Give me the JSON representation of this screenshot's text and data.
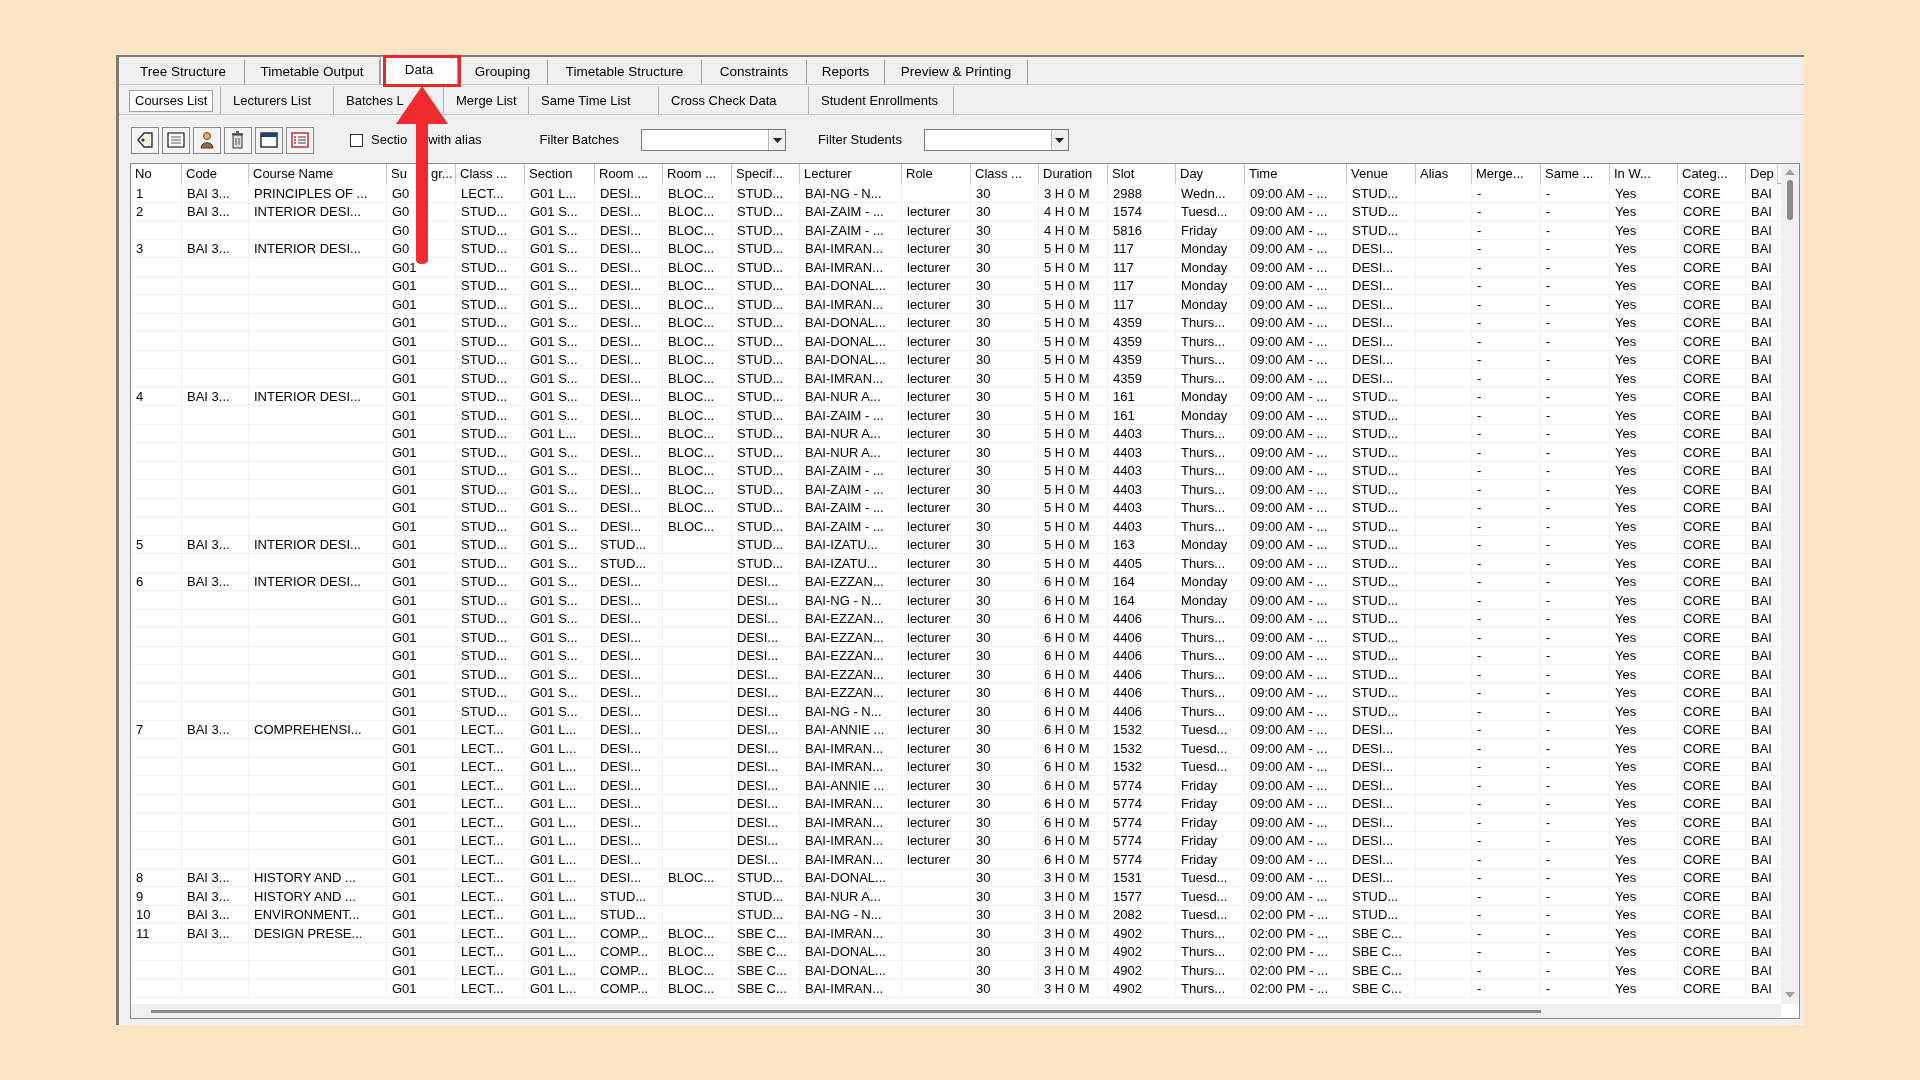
{
  "tabs": [
    {
      "label": "Tree Structure",
      "selected": false
    },
    {
      "label": "Timetable Output",
      "selected": false
    },
    {
      "label": "Data",
      "selected": true
    },
    {
      "label": "Grouping",
      "selected": false
    },
    {
      "label": "Timetable Structure",
      "selected": false
    },
    {
      "label": "Constraints",
      "selected": false
    },
    {
      "label": "Reports",
      "selected": false
    },
    {
      "label": "Preview & Printing",
      "selected": false
    }
  ],
  "sub_tabs": [
    {
      "label": "Courses List",
      "selected": true
    },
    {
      "label": "Lecturers List",
      "selected": false
    },
    {
      "label": "Batches L",
      "selected": false
    },
    {
      "label": "Merge List",
      "selected": false
    },
    {
      "label": "Same Time List",
      "selected": false
    },
    {
      "label": "Cross Check Data",
      "selected": false
    },
    {
      "label": "Student Enrollments",
      "selected": false
    }
  ],
  "toolbar": {
    "sections_checkbox": {
      "label_parts": [
        "Sectio",
        "with alias"
      ],
      "checked": false
    },
    "filter_batches": {
      "label": "Filter Batches"
    },
    "filter_students": {
      "label": "Filter Students"
    }
  },
  "table": {
    "columns": [
      {
        "label_parts": [
          "No"
        ]
      },
      {
        "label_parts": [
          "Code"
        ]
      },
      {
        "label_parts": [
          "Course Name"
        ]
      },
      {
        "label_parts": [
          "Su",
          "gr..."
        ]
      },
      {
        "label_parts": [
          "Class ..."
        ]
      },
      {
        "label_parts": [
          "Section"
        ]
      },
      {
        "label_parts": [
          "Room ..."
        ]
      },
      {
        "label_parts": [
          "Room ..."
        ]
      },
      {
        "label_parts": [
          "Specif..."
        ]
      },
      {
        "label_parts": [
          "Lecturer"
        ]
      },
      {
        "label_parts": [
          "Role"
        ]
      },
      {
        "label_parts": [
          "Class ..."
        ]
      },
      {
        "label_parts": [
          "Duration"
        ]
      },
      {
        "label_parts": [
          "Slot"
        ]
      },
      {
        "label_parts": [
          "Day"
        ]
      },
      {
        "label_parts": [
          "Time"
        ]
      },
      {
        "label_parts": [
          "Venue"
        ]
      },
      {
        "label_parts": [
          "Alias"
        ]
      },
      {
        "label_parts": [
          "Merge..."
        ]
      },
      {
        "label_parts": [
          "Same ..."
        ]
      },
      {
        "label_parts": [
          "In W..."
        ]
      },
      {
        "label_parts": [
          "Categ..."
        ]
      },
      {
        "label_parts": [
          "Dep"
        ]
      }
    ],
    "rows": [
      [
        "1",
        "BAI 3...",
        "PRINCIPLES OF ...",
        "G0",
        "LECT...",
        "G01 L...",
        "DESI...",
        "BLOC...",
        "STUD...",
        "BAI-NG - N...",
        null,
        "30",
        "3 H 0 M",
        "2988",
        "Wedn...",
        "09:00 AM - ...",
        "STUD...",
        null,
        "-",
        "-",
        "Yes",
        "CORE",
        "BAI"
      ],
      [
        "2",
        "BAI 3...",
        "INTERIOR DESI...",
        "G0",
        "STUD...",
        "G01 S...",
        "DESI...",
        "BLOC...",
        "STUD...",
        "BAI-ZAIM - ...",
        "lecturer",
        "30",
        "4 H 0 M",
        "1574",
        "Tuesd...",
        "09:00 AM - ...",
        "STUD...",
        null,
        "-",
        "-",
        "Yes",
        "CORE",
        "BAI"
      ],
      [
        null,
        null,
        null,
        "G0",
        "STUD...",
        "G01 S...",
        "DESI...",
        "BLOC...",
        "STUD...",
        "BAI-ZAIM - ...",
        "lecturer",
        "30",
        "4 H 0 M",
        "5816",
        "Friday",
        "09:00 AM - ...",
        "STUD...",
        null,
        "-",
        "-",
        "Yes",
        "CORE",
        "BAI"
      ],
      [
        "3",
        "BAI 3...",
        "INTERIOR DESI...",
        "G0",
        "STUD...",
        "G01 S...",
        "DESI...",
        "BLOC...",
        "STUD...",
        "BAI-IMRAN...",
        "lecturer",
        "30",
        "5 H 0 M",
        "117",
        "Monday",
        "09:00 AM - ...",
        "DESI...",
        null,
        "-",
        "-",
        "Yes",
        "CORE",
        "BAI"
      ],
      [
        null,
        null,
        null,
        "G01",
        "STUD...",
        "G01 S...",
        "DESI...",
        "BLOC...",
        "STUD...",
        "BAI-IMRAN...",
        "lecturer",
        "30",
        "5 H 0 M",
        "117",
        "Monday",
        "09:00 AM - ...",
        "DESI...",
        null,
        "-",
        "-",
        "Yes",
        "CORE",
        "BAI"
      ],
      [
        null,
        null,
        null,
        "G01",
        "STUD...",
        "G01 S...",
        "DESI...",
        "BLOC...",
        "STUD...",
        "BAI-DONAL...",
        "lecturer",
        "30",
        "5 H 0 M",
        "117",
        "Monday",
        "09:00 AM - ...",
        "DESI...",
        null,
        "-",
        "-",
        "Yes",
        "CORE",
        "BAI"
      ],
      [
        null,
        null,
        null,
        "G01",
        "STUD...",
        "G01 S...",
        "DESI...",
        "BLOC...",
        "STUD...",
        "BAI-IMRAN...",
        "lecturer",
        "30",
        "5 H 0 M",
        "117",
        "Monday",
        "09:00 AM - ...",
        "DESI...",
        null,
        "-",
        "-",
        "Yes",
        "CORE",
        "BAI"
      ],
      [
        null,
        null,
        null,
        "G01",
        "STUD...",
        "G01 S...",
        "DESI...",
        "BLOC...",
        "STUD...",
        "BAI-DONAL...",
        "lecturer",
        "30",
        "5 H 0 M",
        "4359",
        "Thurs...",
        "09:00 AM - ...",
        "DESI...",
        null,
        "-",
        "-",
        "Yes",
        "CORE",
        "BAI"
      ],
      [
        null,
        null,
        null,
        "G01",
        "STUD...",
        "G01 S...",
        "DESI...",
        "BLOC...",
        "STUD...",
        "BAI-DONAL...",
        "lecturer",
        "30",
        "5 H 0 M",
        "4359",
        "Thurs...",
        "09:00 AM - ...",
        "DESI...",
        null,
        "-",
        "-",
        "Yes",
        "CORE",
        "BAI"
      ],
      [
        null,
        null,
        null,
        "G01",
        "STUD...",
        "G01 S...",
        "DESI...",
        "BLOC...",
        "STUD...",
        "BAI-DONAL...",
        "lecturer",
        "30",
        "5 H 0 M",
        "4359",
        "Thurs...",
        "09:00 AM - ...",
        "DESI...",
        null,
        "-",
        "-",
        "Yes",
        "CORE",
        "BAI"
      ],
      [
        null,
        null,
        null,
        "G01",
        "STUD...",
        "G01 S...",
        "DESI...",
        "BLOC...",
        "STUD...",
        "BAI-IMRAN...",
        "lecturer",
        "30",
        "5 H 0 M",
        "4359",
        "Thurs...",
        "09:00 AM - ...",
        "DESI...",
        null,
        "-",
        "-",
        "Yes",
        "CORE",
        "BAI"
      ],
      [
        "4",
        "BAI 3...",
        "INTERIOR DESI...",
        "G01",
        "STUD...",
        "G01 S...",
        "DESI...",
        "BLOC...",
        "STUD...",
        "BAI-NUR A...",
        "lecturer",
        "30",
        "5 H 0 M",
        "161",
        "Monday",
        "09:00 AM - ...",
        "STUD...",
        null,
        "-",
        "-",
        "Yes",
        "CORE",
        "BAI"
      ],
      [
        null,
        null,
        null,
        "G01",
        "STUD...",
        "G01 S...",
        "DESI...",
        "BLOC...",
        "STUD...",
        "BAI-ZAIM - ...",
        "lecturer",
        "30",
        "5 H 0 M",
        "161",
        "Monday",
        "09:00 AM - ...",
        "STUD...",
        null,
        "-",
        "-",
        "Yes",
        "CORE",
        "BAI"
      ],
      [
        null,
        null,
        null,
        "G01",
        "STUD...",
        "G01 L...",
        "DESI...",
        "BLOC...",
        "STUD...",
        "BAI-NUR A...",
        "lecturer",
        "30",
        "5 H 0 M",
        "4403",
        "Thurs...",
        "09:00 AM - ...",
        "STUD...",
        null,
        "-",
        "-",
        "Yes",
        "CORE",
        "BAI"
      ],
      [
        null,
        null,
        null,
        "G01",
        "STUD...",
        "G01 S...",
        "DESI...",
        "BLOC...",
        "STUD...",
        "BAI-NUR A...",
        "lecturer",
        "30",
        "5 H 0 M",
        "4403",
        "Thurs...",
        "09:00 AM - ...",
        "STUD...",
        null,
        "-",
        "-",
        "Yes",
        "CORE",
        "BAI"
      ],
      [
        null,
        null,
        null,
        "G01",
        "STUD...",
        "G01 S...",
        "DESI...",
        "BLOC...",
        "STUD...",
        "BAI-ZAIM - ...",
        "lecturer",
        "30",
        "5 H 0 M",
        "4403",
        "Thurs...",
        "09:00 AM - ...",
        "STUD...",
        null,
        "-",
        "-",
        "Yes",
        "CORE",
        "BAI"
      ],
      [
        null,
        null,
        null,
        "G01",
        "STUD...",
        "G01 S...",
        "DESI...",
        "BLOC...",
        "STUD...",
        "BAI-ZAIM - ...",
        "lecturer",
        "30",
        "5 H 0 M",
        "4403",
        "Thurs...",
        "09:00 AM - ...",
        "STUD...",
        null,
        "-",
        "-",
        "Yes",
        "CORE",
        "BAI"
      ],
      [
        null,
        null,
        null,
        "G01",
        "STUD...",
        "G01 S...",
        "DESI...",
        "BLOC...",
        "STUD...",
        "BAI-ZAIM - ...",
        "lecturer",
        "30",
        "5 H 0 M",
        "4403",
        "Thurs...",
        "09:00 AM - ...",
        "STUD...",
        null,
        "-",
        "-",
        "Yes",
        "CORE",
        "BAI"
      ],
      [
        null,
        null,
        null,
        "G01",
        "STUD...",
        "G01 S...",
        "DESI...",
        "BLOC...",
        "STUD...",
        "BAI-ZAIM - ...",
        "lecturer",
        "30",
        "5 H 0 M",
        "4403",
        "Thurs...",
        "09:00 AM - ...",
        "STUD...",
        null,
        "-",
        "-",
        "Yes",
        "CORE",
        "BAI"
      ],
      [
        "5",
        "BAI 3...",
        "INTERIOR DESI...",
        "G01",
        "STUD...",
        "G01 S...",
        "STUD...",
        null,
        "STUD...",
        "BAI-IZATU...",
        "lecturer",
        "30",
        "5 H 0 M",
        "163",
        "Monday",
        "09:00 AM - ...",
        "STUD...",
        null,
        "-",
        "-",
        "Yes",
        "CORE",
        "BAI"
      ],
      [
        null,
        null,
        null,
        "G01",
        "STUD...",
        "G01 S...",
        "STUD...",
        null,
        "STUD...",
        "BAI-IZATU...",
        "lecturer",
        "30",
        "5 H 0 M",
        "4405",
        "Thurs...",
        "09:00 AM - ...",
        "STUD...",
        null,
        "-",
        "-",
        "Yes",
        "CORE",
        "BAI"
      ],
      [
        "6",
        "BAI 3...",
        "INTERIOR DESI...",
        "G01",
        "STUD...",
        "G01 S...",
        "DESI...",
        null,
        "DESI...",
        "BAI-EZZAN...",
        "lecturer",
        "30",
        "6 H 0 M",
        "164",
        "Monday",
        "09:00 AM - ...",
        "STUD...",
        null,
        "-",
        "-",
        "Yes",
        "CORE",
        "BAI"
      ],
      [
        null,
        null,
        null,
        "G01",
        "STUD...",
        "G01 S...",
        "DESI...",
        null,
        "DESI...",
        "BAI-NG - N...",
        "lecturer",
        "30",
        "6 H 0 M",
        "164",
        "Monday",
        "09:00 AM - ...",
        "STUD...",
        null,
        "-",
        "-",
        "Yes",
        "CORE",
        "BAI"
      ],
      [
        null,
        null,
        null,
        "G01",
        "STUD...",
        "G01 S...",
        "DESI...",
        null,
        "DESI...",
        "BAI-EZZAN...",
        "lecturer",
        "30",
        "6 H 0 M",
        "4406",
        "Thurs...",
        "09:00 AM - ...",
        "STUD...",
        null,
        "-",
        "-",
        "Yes",
        "CORE",
        "BAI"
      ],
      [
        null,
        null,
        null,
        "G01",
        "STUD...",
        "G01 S...",
        "DESI...",
        null,
        "DESI...",
        "BAI-EZZAN...",
        "lecturer",
        "30",
        "6 H 0 M",
        "4406",
        "Thurs...",
        "09:00 AM - ...",
        "STUD...",
        null,
        "-",
        "-",
        "Yes",
        "CORE",
        "BAI"
      ],
      [
        null,
        null,
        null,
        "G01",
        "STUD...",
        "G01 S...",
        "DESI...",
        null,
        "DESI...",
        "BAI-EZZAN...",
        "lecturer",
        "30",
        "6 H 0 M",
        "4406",
        "Thurs...",
        "09:00 AM - ...",
        "STUD...",
        null,
        "-",
        "-",
        "Yes",
        "CORE",
        "BAI"
      ],
      [
        null,
        null,
        null,
        "G01",
        "STUD...",
        "G01 S...",
        "DESI...",
        null,
        "DESI...",
        "BAI-EZZAN...",
        "lecturer",
        "30",
        "6 H 0 M",
        "4406",
        "Thurs...",
        "09:00 AM - ...",
        "STUD...",
        null,
        "-",
        "-",
        "Yes",
        "CORE",
        "BAI"
      ],
      [
        null,
        null,
        null,
        "G01",
        "STUD...",
        "G01 S...",
        "DESI...",
        null,
        "DESI...",
        "BAI-EZZAN...",
        "lecturer",
        "30",
        "6 H 0 M",
        "4406",
        "Thurs...",
        "09:00 AM - ...",
        "STUD...",
        null,
        "-",
        "-",
        "Yes",
        "CORE",
        "BAI"
      ],
      [
        null,
        null,
        null,
        "G01",
        "STUD...",
        "G01 S...",
        "DESI...",
        null,
        "DESI...",
        "BAI-NG - N...",
        "lecturer",
        "30",
        "6 H 0 M",
        "4406",
        "Thurs...",
        "09:00 AM - ...",
        "STUD...",
        null,
        "-",
        "-",
        "Yes",
        "CORE",
        "BAI"
      ],
      [
        "7",
        "BAI 3...",
        "COMPREHENSI...",
        "G01",
        "LECT...",
        "G01 L...",
        "DESI...",
        null,
        "DESI...",
        "BAI-ANNIE ...",
        "lecturer",
        "30",
        "6 H 0 M",
        "1532",
        "Tuesd...",
        "09:00 AM - ...",
        "DESI...",
        null,
        "-",
        "-",
        "Yes",
        "CORE",
        "BAI"
      ],
      [
        null,
        null,
        null,
        "G01",
        "LECT...",
        "G01 L...",
        "DESI...",
        null,
        "DESI...",
        "BAI-IMRAN...",
        "lecturer",
        "30",
        "6 H 0 M",
        "1532",
        "Tuesd...",
        "09:00 AM - ...",
        "DESI...",
        null,
        "-",
        "-",
        "Yes",
        "CORE",
        "BAI"
      ],
      [
        null,
        null,
        null,
        "G01",
        "LECT...",
        "G01 L...",
        "DESI...",
        null,
        "DESI...",
        "BAI-IMRAN...",
        "lecturer",
        "30",
        "6 H 0 M",
        "1532",
        "Tuesd...",
        "09:00 AM - ...",
        "DESI...",
        null,
        "-",
        "-",
        "Yes",
        "CORE",
        "BAI"
      ],
      [
        null,
        null,
        null,
        "G01",
        "LECT...",
        "G01 L...",
        "DESI...",
        null,
        "DESI...",
        "BAI-ANNIE ...",
        "lecturer",
        "30",
        "6 H 0 M",
        "5774",
        "Friday",
        "09:00 AM - ...",
        "DESI...",
        null,
        "-",
        "-",
        "Yes",
        "CORE",
        "BAI"
      ],
      [
        null,
        null,
        null,
        "G01",
        "LECT...",
        "G01 L...",
        "DESI...",
        null,
        "DESI...",
        "BAI-IMRAN...",
        "lecturer",
        "30",
        "6 H 0 M",
        "5774",
        "Friday",
        "09:00 AM - ...",
        "DESI...",
        null,
        "-",
        "-",
        "Yes",
        "CORE",
        "BAI"
      ],
      [
        null,
        null,
        null,
        "G01",
        "LECT...",
        "G01 L...",
        "DESI...",
        null,
        "DESI...",
        "BAI-IMRAN...",
        "lecturer",
        "30",
        "6 H 0 M",
        "5774",
        "Friday",
        "09:00 AM - ...",
        "DESI...",
        null,
        "-",
        "-",
        "Yes",
        "CORE",
        "BAI"
      ],
      [
        null,
        null,
        null,
        "G01",
        "LECT...",
        "G01 L...",
        "DESI...",
        null,
        "DESI...",
        "BAI-IMRAN...",
        "lecturer",
        "30",
        "6 H 0 M",
        "5774",
        "Friday",
        "09:00 AM - ...",
        "DESI...",
        null,
        "-",
        "-",
        "Yes",
        "CORE",
        "BAI"
      ],
      [
        null,
        null,
        null,
        "G01",
        "LECT...",
        "G01 L...",
        "DESI...",
        null,
        "DESI...",
        "BAI-IMRAN...",
        "lecturer",
        "30",
        "6 H 0 M",
        "5774",
        "Friday",
        "09:00 AM - ...",
        "DESI...",
        null,
        "-",
        "-",
        "Yes",
        "CORE",
        "BAI"
      ],
      [
        "8",
        "BAI 3...",
        "HISTORY AND ...",
        "G01",
        "LECT...",
        "G01 L...",
        "DESI...",
        "BLOC...",
        "STUD...",
        "BAI-DONAL...",
        null,
        "30",
        "3 H 0 M",
        "1531",
        "Tuesd...",
        "09:00 AM - ...",
        "DESI...",
        null,
        "-",
        "-",
        "Yes",
        "CORE",
        "BAI"
      ],
      [
        "9",
        "BAI 3...",
        "HISTORY AND ...",
        "G01",
        "LECT...",
        "G01 L...",
        "STUD...",
        null,
        "STUD...",
        "BAI-NUR A...",
        null,
        "30",
        "3 H 0 M",
        "1577",
        "Tuesd...",
        "09:00 AM - ...",
        "STUD...",
        null,
        "-",
        "-",
        "Yes",
        "CORE",
        "BAI"
      ],
      [
        "10",
        "BAI 3...",
        "ENVIRONMENT...",
        "G01",
        "LECT...",
        "G01 L...",
        "STUD...",
        null,
        "STUD...",
        "BAI-NG - N...",
        null,
        "30",
        "3 H 0 M",
        "2082",
        "Tuesd...",
        "02:00 PM - ...",
        "STUD...",
        null,
        "-",
        "-",
        "Yes",
        "CORE",
        "BAI"
      ],
      [
        "11",
        "BAI 3...",
        "DESIGN PRESE...",
        "G01",
        "LECT...",
        "G01 L...",
        "COMP...",
        "BLOC...",
        "SBE C...",
        "BAI-IMRAN...",
        null,
        "30",
        "3 H 0 M",
        "4902",
        "Thurs...",
        "02:00 PM - ...",
        "SBE C...",
        null,
        "-",
        "-",
        "Yes",
        "CORE",
        "BAI"
      ],
      [
        null,
        null,
        null,
        "G01",
        "LECT...",
        "G01 L...",
        "COMP...",
        "BLOC...",
        "SBE C...",
        "BAI-DONAL...",
        null,
        "30",
        "3 H 0 M",
        "4902",
        "Thurs...",
        "02:00 PM - ...",
        "SBE C...",
        null,
        "-",
        "-",
        "Yes",
        "CORE",
        "BAI"
      ],
      [
        null,
        null,
        null,
        "G01",
        "LECT...",
        "G01 L...",
        "COMP...",
        "BLOC...",
        "SBE C...",
        "BAI-DONAL...",
        null,
        "30",
        "3 H 0 M",
        "4902",
        "Thurs...",
        "02:00 PM - ...",
        "SBE C...",
        null,
        "-",
        "-",
        "Yes",
        "CORE",
        "BAI"
      ],
      [
        null,
        null,
        null,
        "G01",
        "LECT...",
        "G01 L...",
        "COMP...",
        "BLOC...",
        "SBE C...",
        "BAI-IMRAN...",
        null,
        "30",
        "3 H 0 M",
        "4902",
        "Thurs...",
        "02:00 PM - ...",
        "SBE C...",
        null,
        "-",
        "-",
        "Yes",
        "CORE",
        "BAI"
      ]
    ]
  }
}
